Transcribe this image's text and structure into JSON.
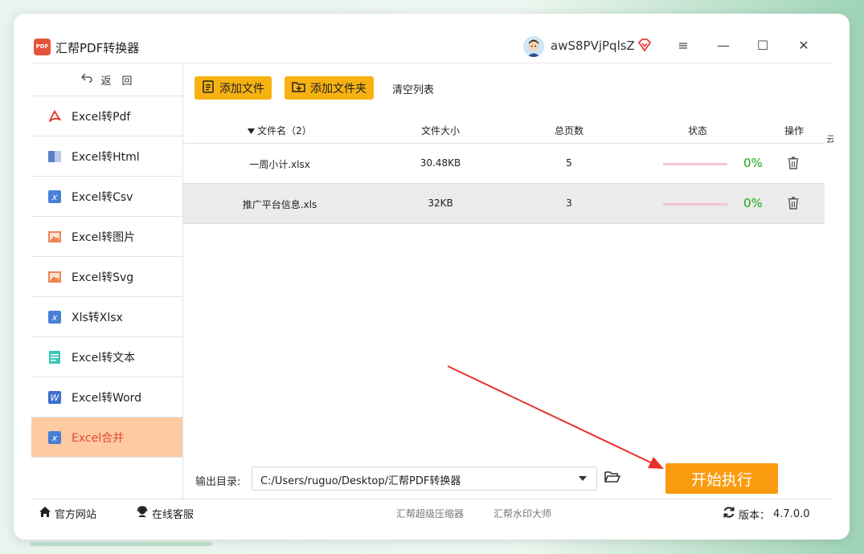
{
  "window": {
    "title": "汇帮PDF转换器",
    "logo_text": "PDF",
    "username": "awS8PVjPqlsZ",
    "controls": {
      "menu": "≡",
      "minimize": "—",
      "maximize": "☐",
      "close": "✕"
    }
  },
  "sidebar": {
    "back_label": "返　回",
    "items": [
      {
        "label": "Excel转Pdf",
        "icon": "pdf-icon"
      },
      {
        "label": "Excel转Html",
        "icon": "html-icon"
      },
      {
        "label": "Excel转Csv",
        "icon": "excel-icon"
      },
      {
        "label": "Excel转图片",
        "icon": "image-icon"
      },
      {
        "label": "Excel转Svg",
        "icon": "image-icon"
      },
      {
        "label": "Xls转Xlsx",
        "icon": "excel-icon"
      },
      {
        "label": "Excel转文本",
        "icon": "text-icon"
      },
      {
        "label": "Excel转Word",
        "icon": "word-icon"
      },
      {
        "label": "Excel合并",
        "icon": "excel-icon",
        "active": true
      }
    ]
  },
  "toolbar": {
    "add_file": "添加文件",
    "add_folder": "添加文件夹",
    "clear_list": "清空列表"
  },
  "table": {
    "headers": {
      "filename": "文件名（2）",
      "size": "文件大小",
      "pages": "总页数",
      "status": "状态",
      "action": "操作"
    },
    "cut_off_header": "云",
    "rows": [
      {
        "filename": "一周小计.xlsx",
        "size": "30.48KB",
        "pages": "5",
        "progress": 0,
        "progress_text": "0%"
      },
      {
        "filename": "推广平台信息.xls",
        "size": "32KB",
        "pages": "3",
        "progress": 0,
        "progress_text": "0%"
      }
    ]
  },
  "output": {
    "label": "输出目录:",
    "path": "C:/Users/ruguo/Desktop/汇帮PDF转换器",
    "start_button": "开始执行"
  },
  "footer": {
    "official_site": "官方网站",
    "online_service": "在线客服",
    "link_compress": "汇帮超级压缩器",
    "link_watermark": "汇帮水印大师",
    "version_label": "版本：",
    "version": "4.7.0.0"
  },
  "colors": {
    "accent_orange": "#fb9b10",
    "toolbar_yellow": "#f7b212",
    "active_nav_bg": "#fdcaa2",
    "active_nav_text": "#e24a2e",
    "progress_green": "#19a319",
    "arrow_red": "#e8322a"
  }
}
